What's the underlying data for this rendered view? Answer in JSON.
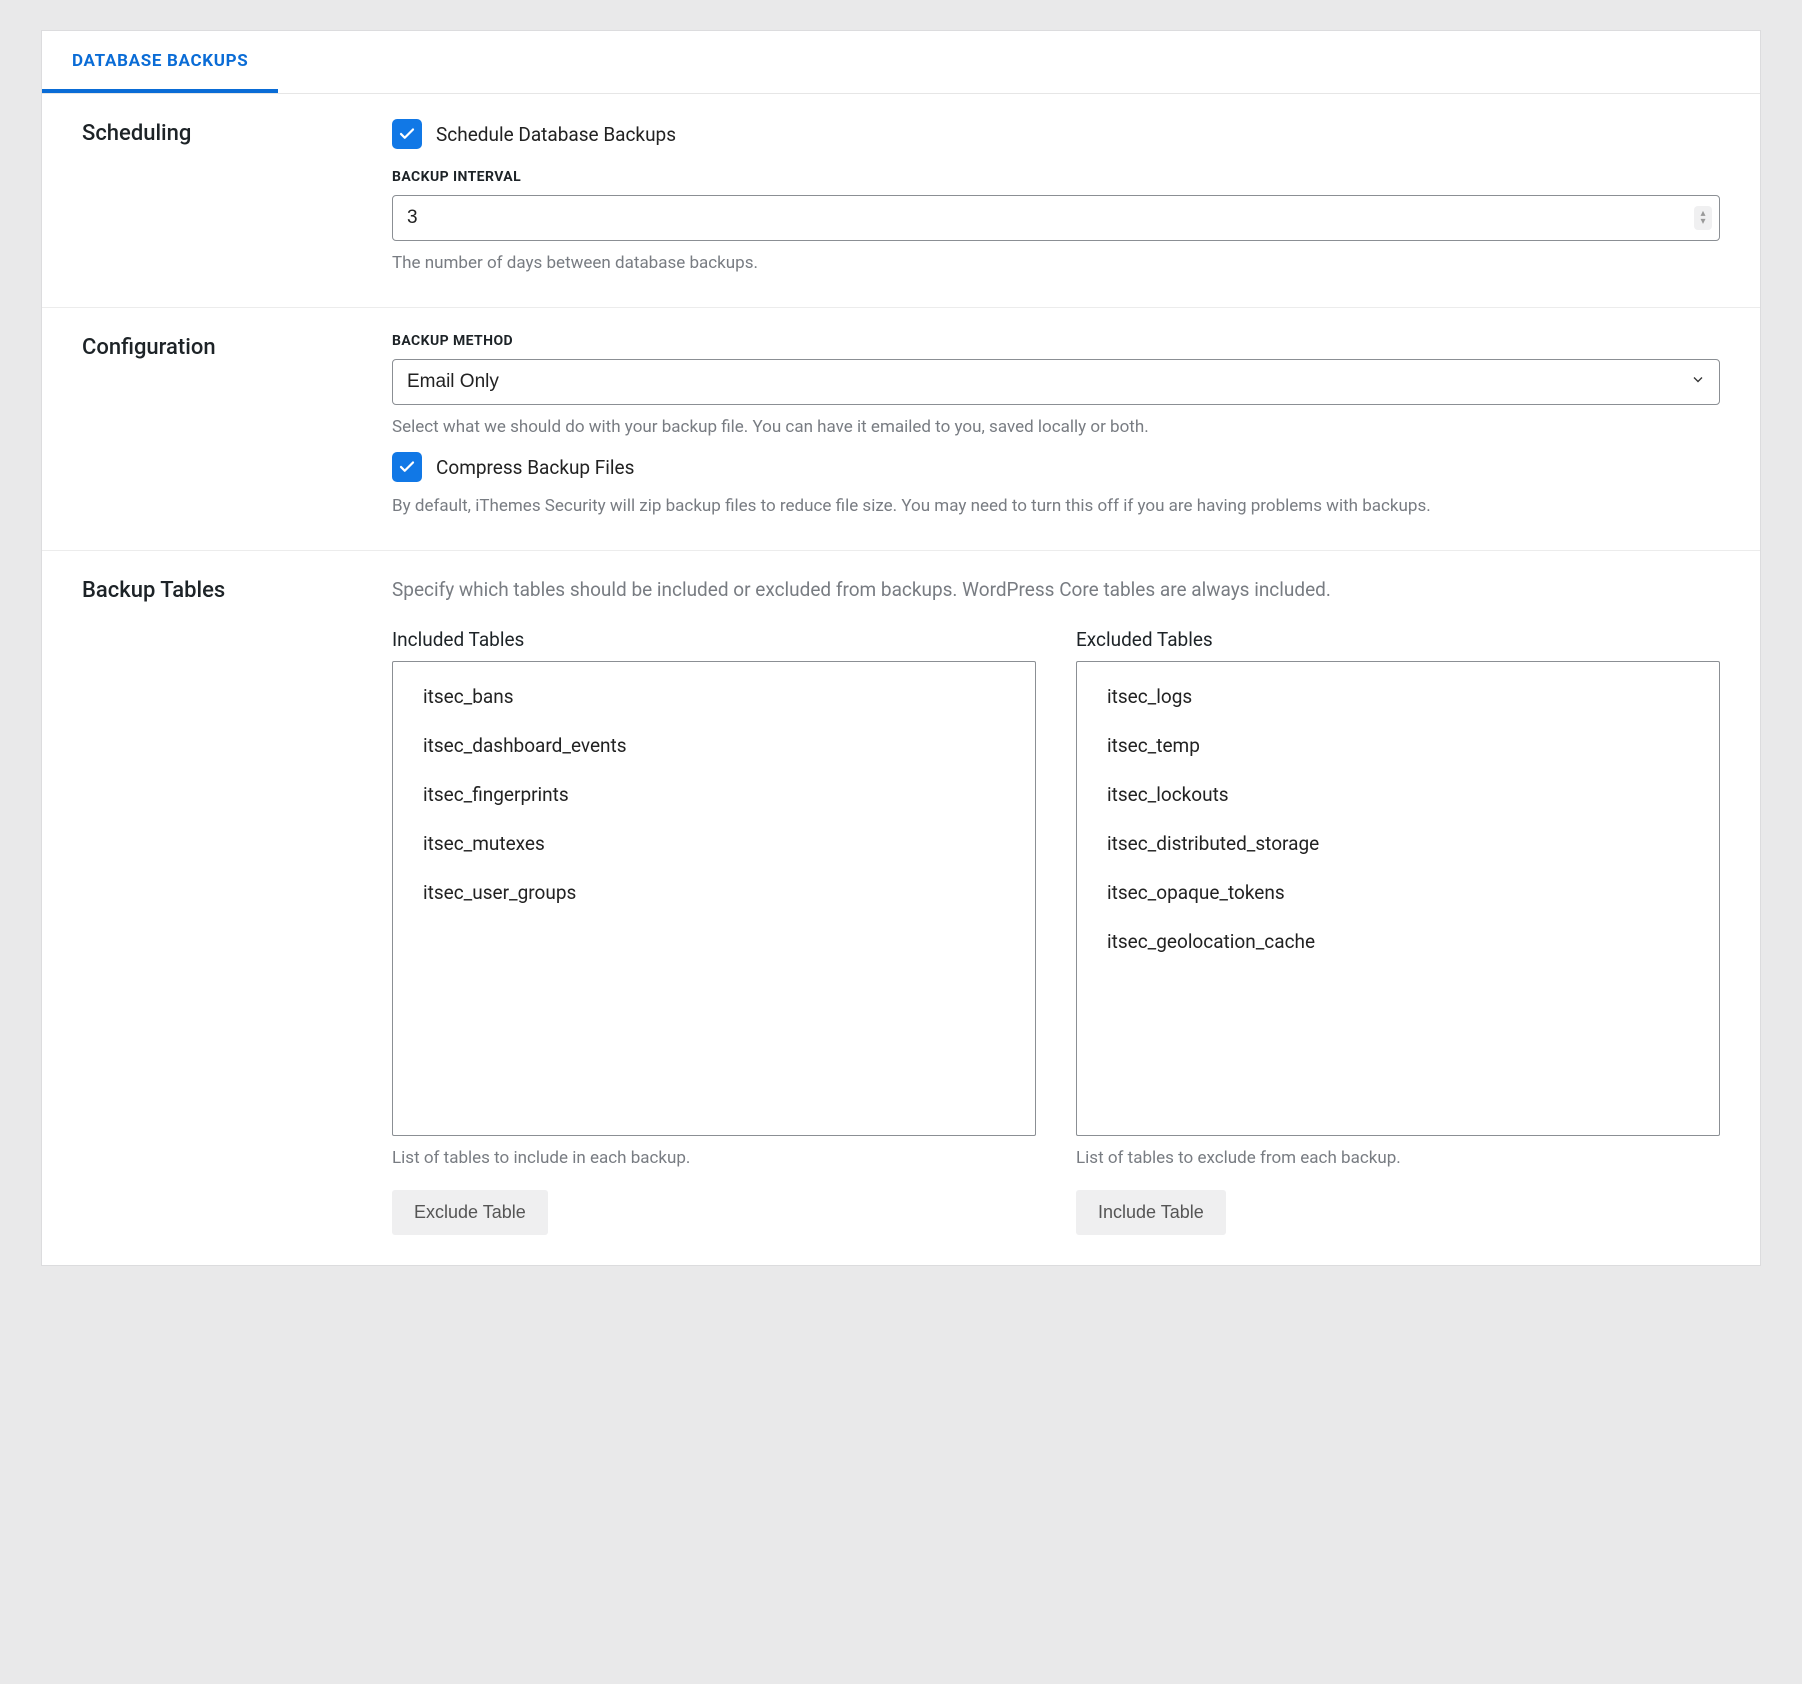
{
  "tab": {
    "label": "DATABASE BACKUPS"
  },
  "scheduling": {
    "title": "Scheduling",
    "schedule_checkbox_label": "Schedule Database Backups",
    "interval_label": "BACKUP INTERVAL",
    "interval_value": "3",
    "interval_help": "The number of days between database backups."
  },
  "configuration": {
    "title": "Configuration",
    "method_label": "BACKUP METHOD",
    "method_value": "Email Only",
    "method_help": "Select what we should do with your backup file. You can have it emailed to you, saved locally or both.",
    "compress_checkbox_label": "Compress Backup Files",
    "compress_help": "By default, iThemes Security will zip backup files to reduce file size. You may need to turn this off if you are having problems with backups."
  },
  "backup_tables": {
    "title": "Backup Tables",
    "intro": "Specify which tables should be included or excluded from backups. WordPress Core tables are always included.",
    "included_heading": "Included Tables",
    "excluded_heading": "Excluded Tables",
    "included_help": "List of tables to include in each backup.",
    "excluded_help": "List of tables to exclude from each backup.",
    "exclude_button": "Exclude Table",
    "include_button": "Include Table",
    "included": [
      "itsec_bans",
      "itsec_dashboard_events",
      "itsec_fingerprints",
      "itsec_mutexes",
      "itsec_user_groups"
    ],
    "excluded": [
      "itsec_logs",
      "itsec_temp",
      "itsec_lockouts",
      "itsec_distributed_storage",
      "itsec_opaque_tokens",
      "itsec_geolocation_cache"
    ]
  }
}
